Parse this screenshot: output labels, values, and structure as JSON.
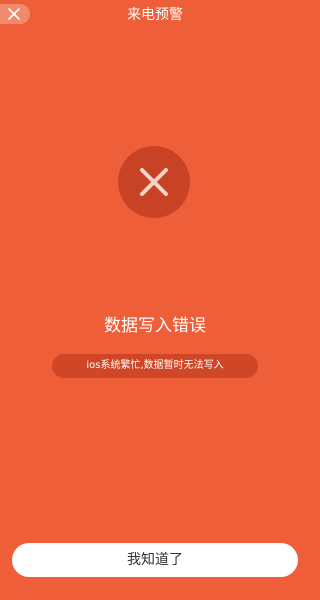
{
  "header": {
    "title": "来电预警",
    "close_icon": "close-icon"
  },
  "status": {
    "icon": "error-x-icon",
    "heading": "数据写入错误",
    "message": "ios系统繁忙,数据暂时无法写入"
  },
  "actions": {
    "confirm_label": "我知道了"
  },
  "colors": {
    "background": "#ee5e38",
    "icon_circle": "#c84325",
    "pill": "#cf4727",
    "button": "#ffffff",
    "button_text": "#333333"
  }
}
